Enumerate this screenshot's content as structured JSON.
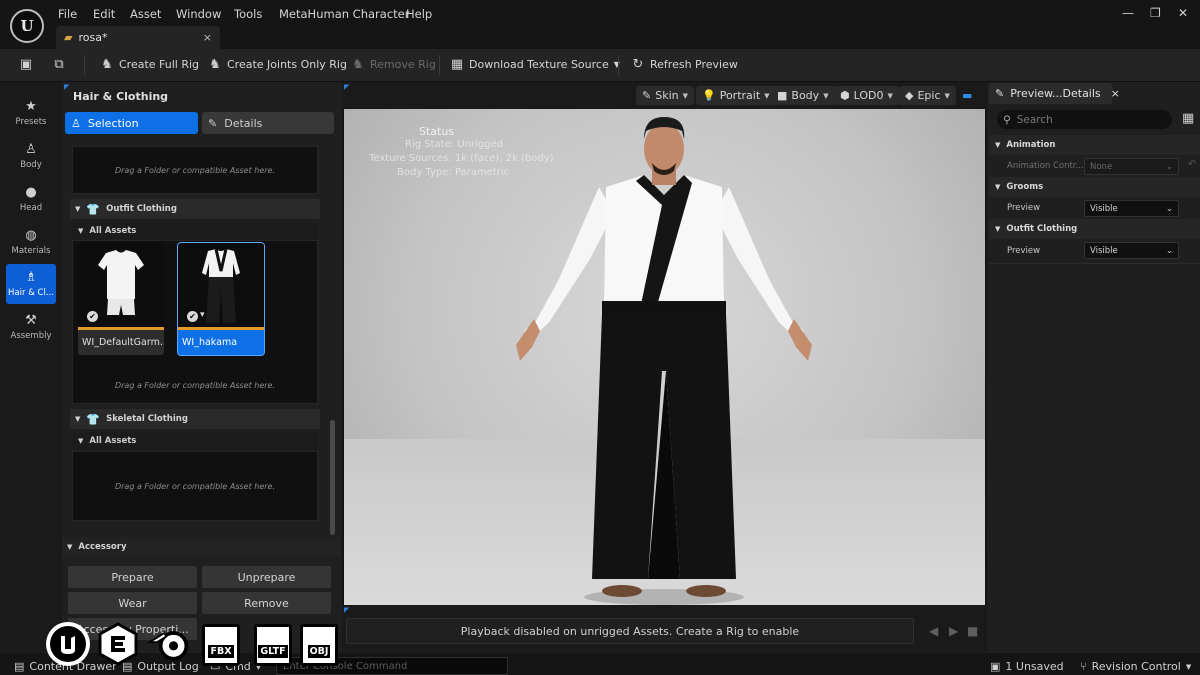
{
  "menu": [
    "File",
    "Edit",
    "Asset",
    "Window",
    "Tools",
    "MetaHuman Character",
    "Help"
  ],
  "logo_text": "U",
  "document_tab": {
    "label": "rosa*",
    "close": "×"
  },
  "window_controls": {
    "minimize": "—",
    "restore": "❐",
    "close": "✕"
  },
  "toolbar": {
    "create_full_rig": "Create Full Rig",
    "create_joints_only_rig": "Create Joints Only Rig",
    "remove_rig": "Remove Rig",
    "download_texture_source": "Download Texture Source",
    "refresh_preview": "Refresh Preview"
  },
  "left_nav": [
    {
      "label": "Presets",
      "icon": "star-icon"
    },
    {
      "label": "Body",
      "icon": "body-icon"
    },
    {
      "label": "Head",
      "icon": "head-icon"
    },
    {
      "label": "Materials",
      "icon": "materials-icon"
    },
    {
      "label": "Hair & Cl...",
      "icon": "hair-clothing-icon",
      "active": true
    },
    {
      "label": "Assembly",
      "icon": "hammer-icon"
    }
  ],
  "left_panel": {
    "title": "Hair & Clothing",
    "tab_selection": "Selection",
    "tab_details": "Details",
    "drop_hint": "Drag a Folder or compatible Asset here.",
    "outfit_section": "Outfit Clothing",
    "all_assets": "All Assets",
    "assets": [
      {
        "name": "WI_DefaultGarm...",
        "selected": false
      },
      {
        "name": "WI_hakama",
        "selected": true
      }
    ],
    "skeletal_section": "Skeletal Clothing",
    "accessory_section": "Accessory",
    "buttons": {
      "prepare": "Prepare",
      "unprepare": "Unprepare",
      "wear": "Wear",
      "remove": "Remove",
      "accessory_properties": "Accessory Properti..."
    }
  },
  "viewport_toolbar": {
    "skin": "Skin",
    "portrait": "Portrait",
    "body": "Body",
    "lod": "LOD0",
    "quality": "Epic"
  },
  "viewport_status": {
    "title": "Status",
    "rig_state": "Rig State: Unrigged",
    "texture_sources": "Texture Sources: 1k (face), 2k (body)",
    "body_type": "Body Type: Parametric"
  },
  "playback_message": "Playback disabled on unrigged Assets. Create a Rig to enable",
  "right_panel": {
    "tab": "Preview...Details",
    "tab_close": "×",
    "search_placeholder": "Search",
    "animation_section": "Animation",
    "animation_controller_label": "Animation Contr...",
    "animation_controller_value": "None",
    "grooms_section": "Grooms",
    "grooms_preview_label": "Preview",
    "grooms_preview_value": "Visible",
    "outfit_section": "Outfit Clothing",
    "outfit_preview_label": "Preview",
    "outfit_preview_value": "Visible"
  },
  "status_bar": {
    "content_drawer": "Content Drawer",
    "output_log": "Output Log",
    "cmd": "Cmd",
    "console_placeholder": "Enter Console Command",
    "unsaved": "1 Unsaved",
    "revision_control": "Revision Control"
  },
  "overlay_badges": [
    "FBX",
    "GLTF",
    "OBJ"
  ],
  "colors": {
    "accent": "#0e70e6",
    "thumb_bar": "#e29a2a"
  }
}
